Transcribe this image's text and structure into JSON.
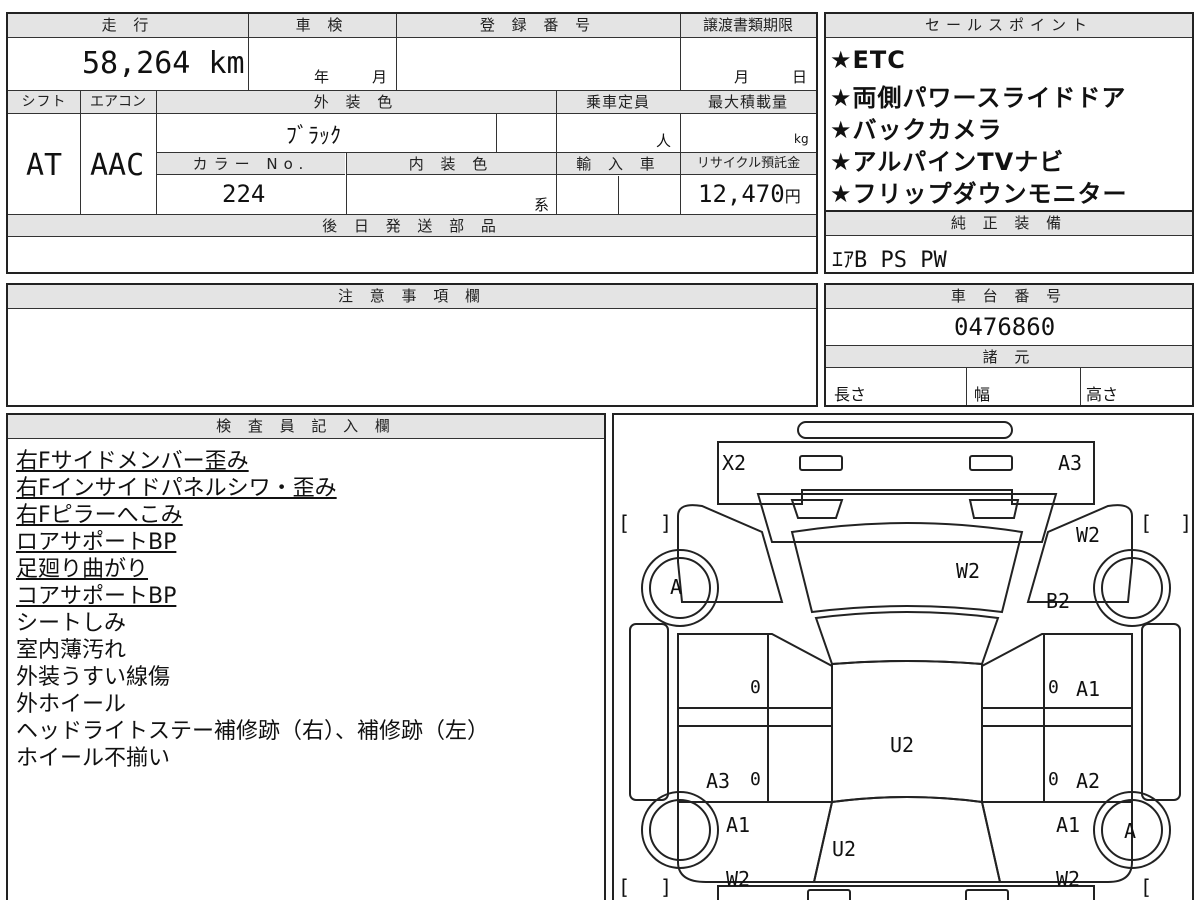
{
  "vehicle": {
    "mileage_value": "58,264",
    "mileage_unit": "km",
    "inspection_year_label": "年",
    "inspection_month_label": "月",
    "registration_number": "",
    "transfer_month_label": "月",
    "transfer_day_label": "日",
    "shift": "AT",
    "aircon": "AAC",
    "exterior_color": "ﾌﾞﾗｯｸ",
    "capacity_unit": "人",
    "max_load_unit": "kg",
    "color_no": "224",
    "interior_color_unit": "系",
    "recycle_fee": "12,470",
    "recycle_fee_unit": "円",
    "chassis_number": "0476860"
  },
  "labels": {
    "mileage": "走 行",
    "inspection": "車 検",
    "registration": "登 録 番 号",
    "transfer_deadline": "譲渡書類期限",
    "shift": "シフト",
    "aircon": "エアコン",
    "exterior_color": "外 装 色",
    "capacity": "乗車定員",
    "max_load": "最大積載量",
    "color_no": "カラー No.",
    "interior_color": "内 装 色",
    "imported": "輸 入 車",
    "recycle_fee": "リサイクル預託金",
    "later_parts": "後 日 発 送 部 品",
    "sales_points": "セールスポイント",
    "original_equipment": "純 正 装 備",
    "notes": "注 意 事 項 欄",
    "chassis_number": "車 台 番 号",
    "specs": "諸 元",
    "length": "長さ",
    "width": "幅",
    "height": "高さ",
    "inspector": "検 査 員 記 入 欄"
  },
  "sales_points": [
    "★ETC",
    "★両側パワースライドドア",
    "★バックカメラ",
    "★アルパインTVナビ",
    "★フリップダウンモニター"
  ],
  "original_equipment": "ｴｱB PS PW",
  "inspector_notes": [
    {
      "text": "右Fサイドメンバー歪み",
      "underline": true
    },
    {
      "text": "右Fインサイドパネルシワ・歪み",
      "underline": true
    },
    {
      "text": "右Fピラーへこみ",
      "underline": true
    },
    {
      "text": "ロアサポートBP",
      "underline": true
    },
    {
      "text": "足廻り曲がり",
      "underline": true
    },
    {
      "text": "コアサポートBP",
      "underline": true
    },
    {
      "text": "シートしみ",
      "underline": false
    },
    {
      "text": "室内薄汚れ",
      "underline": false
    },
    {
      "text": "外装うすい線傷",
      "underline": false
    },
    {
      "text": "外ホイール",
      "underline": false
    },
    {
      "text": "ヘッドライトステー補修跡（右）、補修跡（左）",
      "underline": false
    },
    {
      "text": "ホイール不揃い",
      "underline": false
    }
  ],
  "diagram": {
    "marks": {
      "x2": "X2",
      "a3_top": "A3",
      "w2_roof": "W2",
      "w2_right_top": "W2",
      "b2": "B2",
      "a_left_wheel": "A",
      "zero_left_mid": "0",
      "zero_right_mid": "0",
      "a1_right_mid": "A1",
      "u2_center": "U2",
      "a3_left_low": "A3",
      "zero_left_low": "0",
      "zero_right_low": "0",
      "a2_right_low": "A2",
      "a1_left_low": "A1",
      "a1_right_low": "A1",
      "a_right_wheel": "A",
      "u2_rear": "U2",
      "w2_left_bottom": "W2",
      "w2_right_bottom": "W2",
      "bracket_open": "[",
      "bracket_close": "]"
    }
  }
}
